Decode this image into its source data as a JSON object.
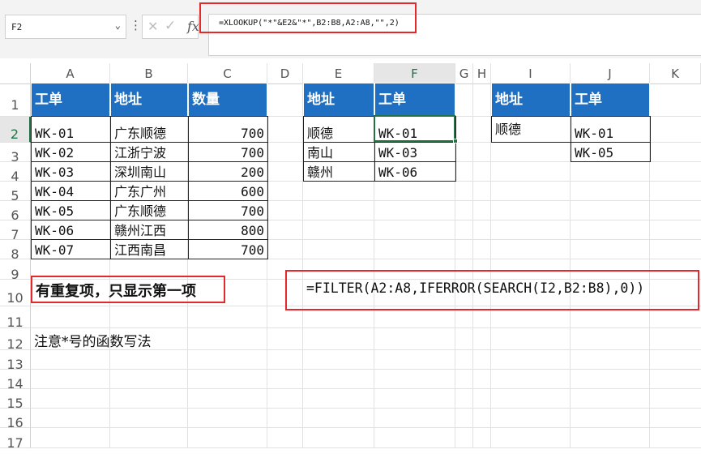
{
  "namebox": {
    "value": "F2"
  },
  "formula_bar": {
    "fx_label": "fx",
    "formula": "=XLOOKUP(\"*\"&E2&\"*\",B2:B8,A2:A8,\"\",2)"
  },
  "columns": [
    "A",
    "B",
    "C",
    "D",
    "E",
    "F",
    "G",
    "H",
    "I",
    "J",
    "K"
  ],
  "rows": [
    "1",
    "2",
    "3",
    "4",
    "5",
    "6",
    "7",
    "8",
    "9",
    "10",
    "11",
    "12",
    "13",
    "14",
    "15",
    "16",
    "17"
  ],
  "table_main": {
    "headers": [
      "工单",
      "地址",
      "数量"
    ],
    "rows": [
      [
        "WK-01",
        "广东顺德",
        "700"
      ],
      [
        "WK-02",
        "江浙宁波",
        "700"
      ],
      [
        "WK-03",
        "深圳南山",
        "200"
      ],
      [
        "WK-04",
        "广东广州",
        "600"
      ],
      [
        "WK-05",
        "广东顺德",
        "700"
      ],
      [
        "WK-06",
        "赣州江西",
        "800"
      ],
      [
        "WK-07",
        "江西南昌",
        "700"
      ]
    ]
  },
  "table_lookup": {
    "headers": [
      "地址",
      "工单"
    ],
    "rows": [
      [
        "顺德",
        "WK-01"
      ],
      [
        "南山",
        "WK-03"
      ],
      [
        "赣州",
        "WK-06"
      ]
    ]
  },
  "table_filter": {
    "headers": [
      "地址",
      "工单"
    ],
    "address": "顺德",
    "results": [
      "WK-01",
      "WK-05"
    ]
  },
  "notes": {
    "duplicate_note": "有重复项，只显示第一项",
    "filter_formula": "=FILTER(A2:A8,IFERROR(SEARCH(I2,B2:B8),0))",
    "star_note": "注意*号的函数写法"
  },
  "colors": {
    "header_blue": "#1f6fc3",
    "highlight_red": "#e5282b",
    "excel_green": "#217346"
  }
}
